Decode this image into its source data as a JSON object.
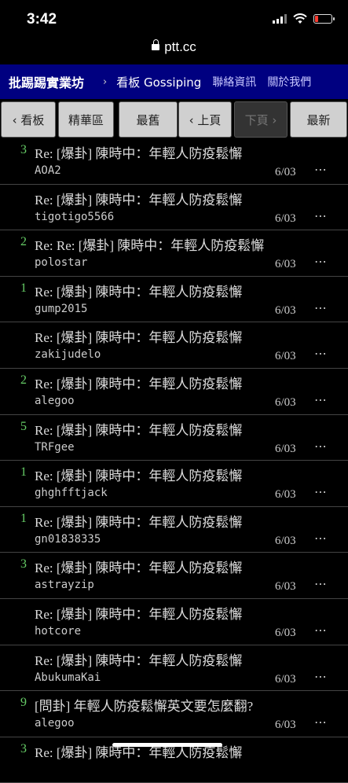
{
  "status": {
    "time": "3:42"
  },
  "url": {
    "domain": "ptt.cc"
  },
  "header": {
    "site_name": "批踢踢實業坊",
    "separator": "›",
    "board_label": "看板 Gossiping",
    "links": [
      "聯絡資訊",
      "關於我們"
    ]
  },
  "nav": {
    "board": "‹ 看板",
    "digest": "精華區",
    "oldest": "最舊",
    "prev": "‹ 上頁",
    "next": "下頁 ›",
    "newest": "最新"
  },
  "posts": [
    {
      "nrec": "3",
      "title": "Re: [爆卦] 陳時中：年輕人防疫鬆懈",
      "author": "AOA2",
      "date": "6/03",
      "more": "⋯"
    },
    {
      "nrec": "",
      "title": "Re: [爆卦] 陳時中：年輕人防疫鬆懈",
      "author": "tigotigo5566",
      "date": "6/03",
      "more": "⋯"
    },
    {
      "nrec": "2",
      "title": "Re: Re: [爆卦] 陳時中：年輕人防疫鬆懈",
      "author": "polostar",
      "date": "6/03",
      "more": "⋯"
    },
    {
      "nrec": "1",
      "title": "Re: [爆卦] 陳時中：年輕人防疫鬆懈",
      "author": "gump2015",
      "date": "6/03",
      "more": "⋯"
    },
    {
      "nrec": "",
      "title": "Re: [爆卦] 陳時中：年輕人防疫鬆懈",
      "author": "zakijudelo",
      "date": "6/03",
      "more": "⋯"
    },
    {
      "nrec": "2",
      "title": "Re: [爆卦] 陳時中：年輕人防疫鬆懈",
      "author": "alegoo",
      "date": "6/03",
      "more": "⋯"
    },
    {
      "nrec": "5",
      "title": "Re: [爆卦] 陳時中：年輕人防疫鬆懈",
      "author": "TRFgee",
      "date": "6/03",
      "more": "⋯"
    },
    {
      "nrec": "1",
      "title": "Re: [爆卦] 陳時中：年輕人防疫鬆懈",
      "author": "ghghfftjack",
      "date": "6/03",
      "more": "⋯"
    },
    {
      "nrec": "1",
      "title": "Re: [爆卦] 陳時中：年輕人防疫鬆懈",
      "author": "gn01838335",
      "date": "6/03",
      "more": "⋯"
    },
    {
      "nrec": "3",
      "title": "Re: [爆卦] 陳時中：年輕人防疫鬆懈",
      "author": "astrayzip",
      "date": "6/03",
      "more": "⋯"
    },
    {
      "nrec": "",
      "title": "Re: [爆卦] 陳時中：年輕人防疫鬆懈",
      "author": "hotcore",
      "date": "6/03",
      "more": "⋯"
    },
    {
      "nrec": "",
      "title": "Re: [爆卦] 陳時中：年輕人防疫鬆懈",
      "author": "AbukumaKai",
      "date": "6/03",
      "more": "⋯"
    },
    {
      "nrec": "9",
      "title": "[問卦] 年輕人防疫鬆懈英文要怎麼翻?",
      "author": "alegoo",
      "date": "6/03",
      "more": "⋯"
    },
    {
      "nrec": "3",
      "title": "Re: [爆卦] 陳時中：年輕人防疫鬆懈",
      "author": "",
      "date": "",
      "more": ""
    }
  ]
}
